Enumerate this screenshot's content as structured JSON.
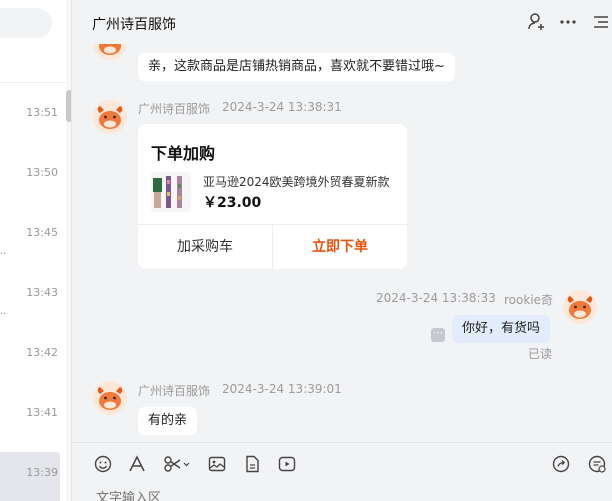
{
  "header": {
    "title": "广州诗百服饰"
  },
  "sidebar": {
    "times": [
      "13:51",
      "13:50",
      "13:45",
      "13:43",
      "13:42",
      "13:41",
      "13:39"
    ]
  },
  "messages": {
    "m1": {
      "text": "亲，这款商品是店铺热销商品，喜欢就不要错过哦~"
    },
    "m2": {
      "sender": "广州诗百服饰",
      "time": "2024-3-24 13:38:31",
      "card": {
        "title": "下单加购",
        "product_name": "亚马逊2024欧美跨境外贸春夏新款",
        "price": "￥23.00",
        "cart_label": "加采购车",
        "buy_label": "立即下单"
      }
    },
    "m3": {
      "time": "2024-3-24 13:38:33",
      "sender": "rookie奇",
      "text": "你好，有货吗",
      "status": "已读"
    },
    "m4": {
      "sender": "广州诗百服饰",
      "time": "2024-3-24 13:39:01",
      "text": "有的亲"
    }
  },
  "input": {
    "placeholder": "文字输入区"
  },
  "colors": {
    "accent": "#e8540f",
    "mine_bubble": "#e3ecfc",
    "avatar_orange": "#f07a3a"
  }
}
